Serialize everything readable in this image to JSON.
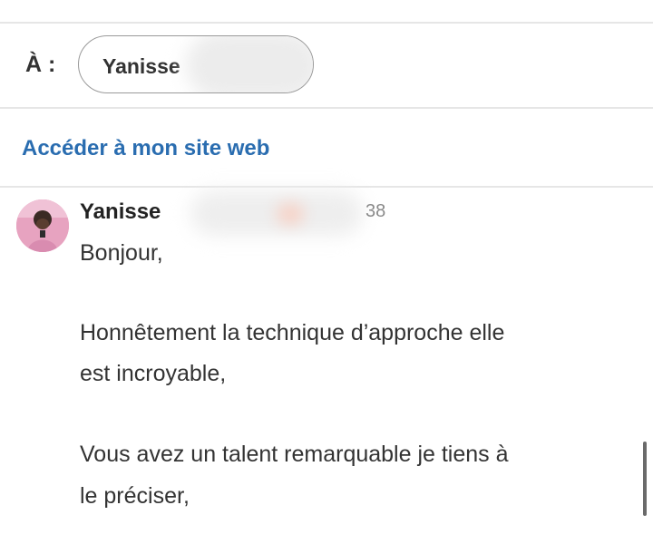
{
  "compose": {
    "to_label": "À :",
    "recipient_chip": "Yanisse"
  },
  "website_link": "Accéder à mon site web",
  "message": {
    "sender_name": "Yanisse",
    "timestamp_visible": "38",
    "lines": [
      "Bonjour,",
      "Honnêtement la technique d’approche elle",
      "est incroyable,",
      "Vous avez un talent remarquable je tiens à",
      "le préciser,"
    ]
  },
  "colors": {
    "link": "#2a6db0",
    "divider": "#e6e6e6",
    "avatar_bg": "#e7a3c0"
  },
  "icons": {
    "avatar": "person-avatar-photo"
  }
}
